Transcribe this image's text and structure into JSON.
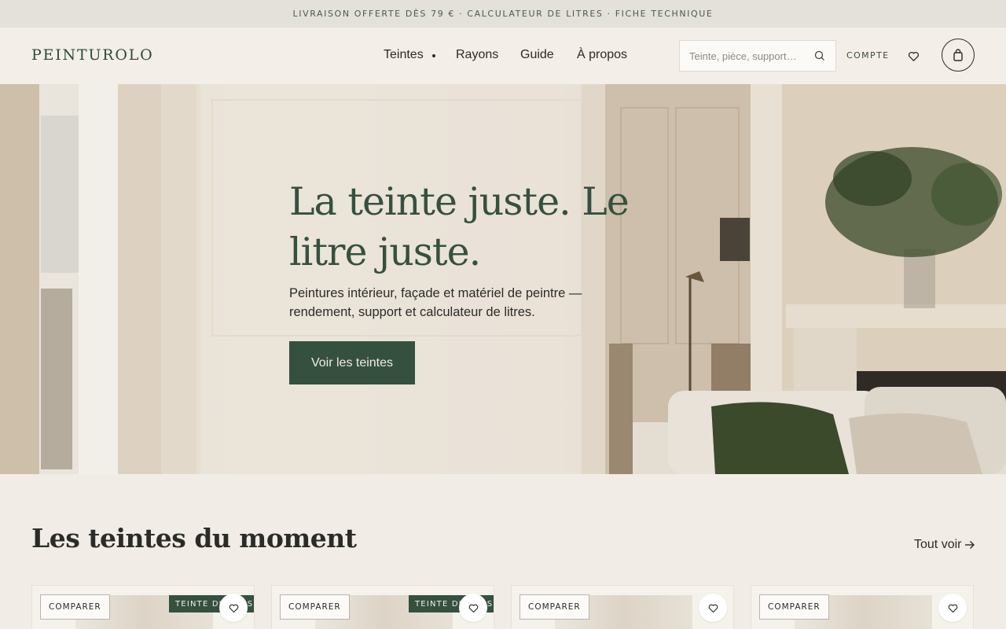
{
  "announcement": {
    "text": "LIVRAISON OFFERTE DÈS 79 € · CALCULATEUR DE LITRES · FICHE TECHNIQUE"
  },
  "header": {
    "logo": "PEINTUROLO",
    "nav": [
      {
        "label": "Teintes"
      },
      {
        "label": "Rayons"
      },
      {
        "label": "Guide"
      },
      {
        "label": "À propos"
      }
    ],
    "search": {
      "placeholder": "Teinte, pièce, support…",
      "value": ""
    },
    "account_label": "COMPTE"
  },
  "hero": {
    "title": "La teinte juste. Le litre juste.",
    "subtitle": "Peintures intérieur, façade et matériel de peintre — rendement, support et calculateur de litres.",
    "cta": "Voir les teintes"
  },
  "section": {
    "title": "Les teintes du moment",
    "see_all": "Tout voir"
  },
  "cards": [
    {
      "compare": "COMPARER",
      "badge": "TEINTE DU MOIS"
    },
    {
      "compare": "COMPARER",
      "badge": "TEINTE DU MOIS"
    },
    {
      "compare": "COMPARER",
      "badge": ""
    },
    {
      "compare": "COMPARER",
      "badge": ""
    }
  ],
  "colors": {
    "brand_green": "#35503f",
    "page_bg": "#f1ece5",
    "announce_bg": "#e3e1da"
  },
  "icons": [
    "search-icon",
    "heart-icon",
    "bag-icon",
    "arrow-right-icon",
    "chevron-down-icon"
  ]
}
